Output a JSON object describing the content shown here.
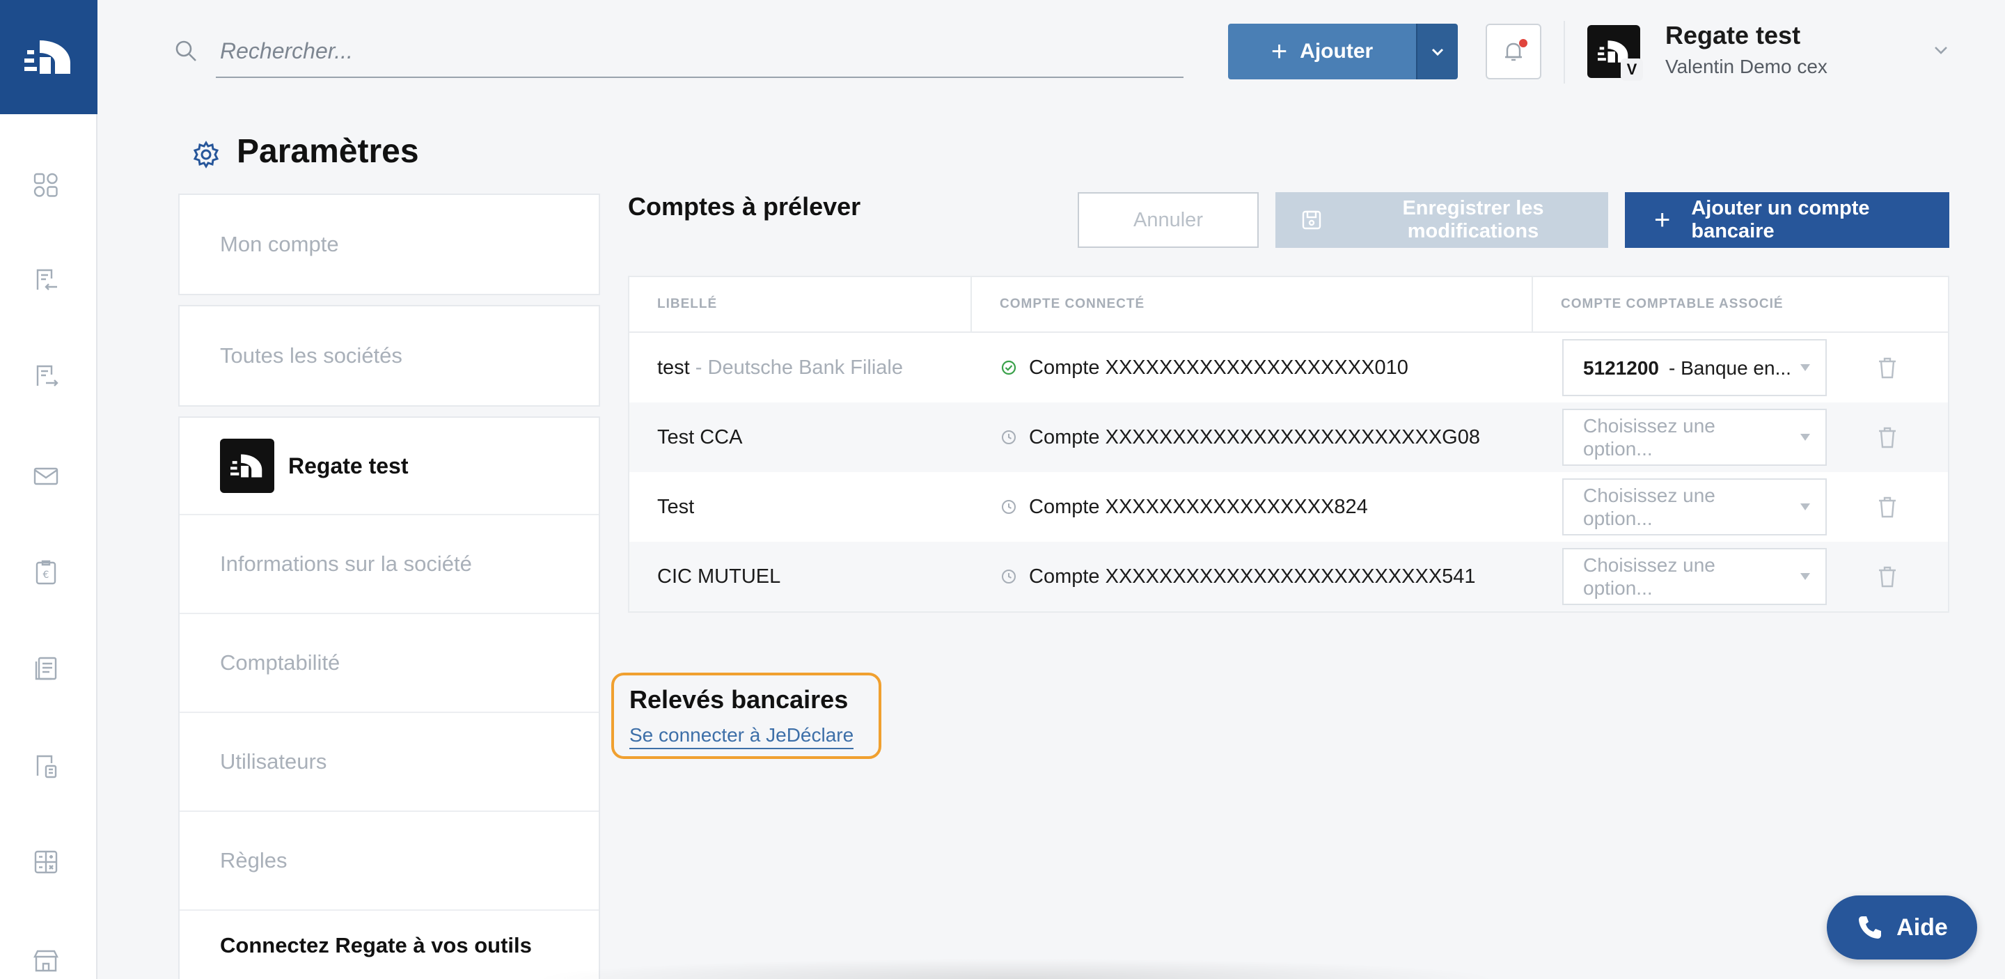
{
  "topbar": {
    "search_placeholder": "Rechercher...",
    "add_label": "Ajouter",
    "org_name": "Regate test",
    "user_name": "Valentin Demo cex",
    "avatar_initial": "V"
  },
  "page": {
    "title": "Paramètres"
  },
  "settings_nav": {
    "my_account": "Mon compte",
    "all_companies": "Toutes les sociétés",
    "company_name": "Regate test",
    "items": [
      "Informations sur la société",
      "Comptabilité",
      "Utilisateurs",
      "Règles"
    ],
    "connect": "Connectez Regate à vos outils"
  },
  "section": {
    "title": "Comptes à prélever",
    "cancel": "Annuler",
    "save": "Enregistrer les modifications",
    "add_bank": "Ajouter un compte bancaire"
  },
  "table": {
    "headers": [
      "LIBELLÉ",
      "COMPTE CONNECTÉ",
      "COMPTE COMPTABLE ASSOCIÉ"
    ],
    "rows": [
      {
        "label": "test",
        "bank": " - Deutsche Bank Filiale",
        "account": "Compte XXXXXXXXXXXXXXXXXXXX010",
        "status": "connected",
        "code": "5121200",
        "ledger": " - Banque en...",
        "placeholder": ""
      },
      {
        "label": "Test CCA",
        "bank": "",
        "account": "Compte XXXXXXXXXXXXXXXXXXXXXXXXXG08",
        "status": "pending",
        "code": "",
        "ledger": "",
        "placeholder": "Choisissez une option..."
      },
      {
        "label": "Test",
        "bank": "",
        "account": "Compte XXXXXXXXXXXXXXXXX824",
        "status": "pending",
        "code": "",
        "ledger": "",
        "placeholder": "Choisissez une option..."
      },
      {
        "label": "CIC MUTUEL",
        "bank": "",
        "account": "Compte XXXXXXXXXXXXXXXXXXXXXXXXX541",
        "status": "pending",
        "code": "",
        "ledger": "",
        "placeholder": "Choisissez une option..."
      }
    ]
  },
  "releves": {
    "title": "Relevés bancaires",
    "link": "Se connecter à JeDéclare"
  },
  "help": {
    "label": "Aide"
  },
  "colors": {
    "brand_dark": "#1d4c8c",
    "primary": "#27569a",
    "accent_button": "#4a7fb5",
    "highlight": "#f0a030",
    "connected": "#3aa14a"
  },
  "icons": {
    "rail": [
      "dashboard-icon",
      "invoice-in-icon",
      "invoice-out-icon",
      "mail-icon",
      "expense-icon",
      "documents-icon",
      "calculator-doc-icon",
      "calculator-icon",
      "bank-icon"
    ]
  }
}
